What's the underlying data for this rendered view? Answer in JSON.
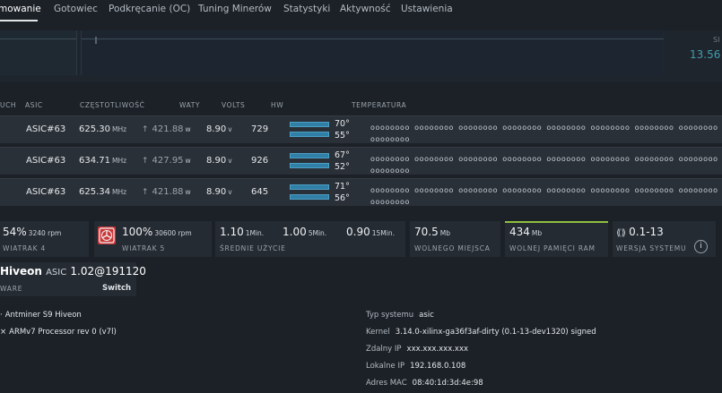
{
  "nav": {
    "tabs": [
      "mowanie",
      "Gotowiec",
      "Podkręcanie (OC)",
      "Tuning Minerów",
      "Statystyki",
      "Aktywność",
      "Ustawienia"
    ]
  },
  "hashrate": {
    "label": "SI",
    "value": "13.56"
  },
  "table": {
    "headers": [
      "UCH",
      "ASIC",
      "CZĘSTOTLIWOŚĆ",
      "WATY",
      "VOLTS",
      "HW",
      "TEMPERATURA"
    ],
    "rows": [
      {
        "asic": "ASIC#63",
        "freq": "625.30",
        "freq_unit": "MHz",
        "fan": "421.88",
        "fan_unit": "w",
        "volts": "8.90",
        "volts_unit": "v",
        "hw": "729",
        "temp1": "70°",
        "temp2": "55°",
        "chips": "oooooooo oooooooo oooooooo oooooooo oooooooo oooooooo oooooooo oooooooo oooooooo"
      },
      {
        "asic": "ASIC#63",
        "freq": "634.71",
        "freq_unit": "MHz",
        "fan": "427.95",
        "fan_unit": "w",
        "volts": "8.90",
        "volts_unit": "v",
        "hw": "926",
        "temp1": "67°",
        "temp2": "52°",
        "chips": "oooooooo oooooooo oooooooo oooooooo oooooooo oooooooo oooooooo oooooooo oooooooo"
      },
      {
        "asic": "ASIC#63",
        "freq": "625.34",
        "freq_unit": "MHz",
        "fan": "421.88",
        "fan_unit": "w",
        "volts": "8.90",
        "volts_unit": "v",
        "hw": "645",
        "temp1": "71°",
        "temp2": "56°",
        "chips": "oooooooo oooooooo oooooooo oooooooo oooooooo oooooooo oooooooo oooooooo oooooooo"
      }
    ]
  },
  "stats": {
    "fan4": {
      "value": "54%",
      "rpm": "3240 rpm",
      "label": "WIATRAK 4"
    },
    "fan5": {
      "value": "100%",
      "rpm": "30600 rpm",
      "label": "WIATRAK 5"
    },
    "load": {
      "v1": "1.10",
      "u1": "1Min.",
      "v2": "1.00",
      "u2": "5Min.",
      "v3": "0.90",
      "u3": "15Min.",
      "label": "ŚREDNIE UŻYCIE"
    },
    "disk": {
      "value": "70.5",
      "unit": "Mb",
      "label": "WOLNEGO MIEJSCA"
    },
    "ram": {
      "value": "434",
      "unit": "Mb",
      "label": "WOLNEJ PAMIĘCI RAM"
    },
    "version": {
      "value": "0.1-13",
      "label": "WERSJA SYSTEMU"
    },
    "info_icon": "i"
  },
  "firmware": {
    "name": "Hiveon",
    "asic": "ASIC",
    "version": "1.02@191120",
    "ware": "WARE",
    "switch": "Switch"
  },
  "system": {
    "model": "Antminer S9 Hiveon",
    "cpu": "ARMv7 Processor rev 0 (v7l)",
    "type_label": "Typ systemu",
    "type": "asic",
    "kernel_label": "Kernel",
    "kernel": "3.14.0-xilinx-ga36f3af-dirty (0.1-13-dev1320) signed",
    "remote_ip_label": "Zdalny IP",
    "remote_ip": "xxx.xxx.xxx.xxx",
    "local_ip_label": "Lokalne IP",
    "local_ip": "192.168.0.108",
    "mac_label": "Adres MAC",
    "mac": "08:40:1d:3d:4e:98"
  },
  "colors": {
    "accent_blue": "#3f9fb0",
    "fan_alert": "#c9383a",
    "ram_line": "#8dbf3c"
  }
}
